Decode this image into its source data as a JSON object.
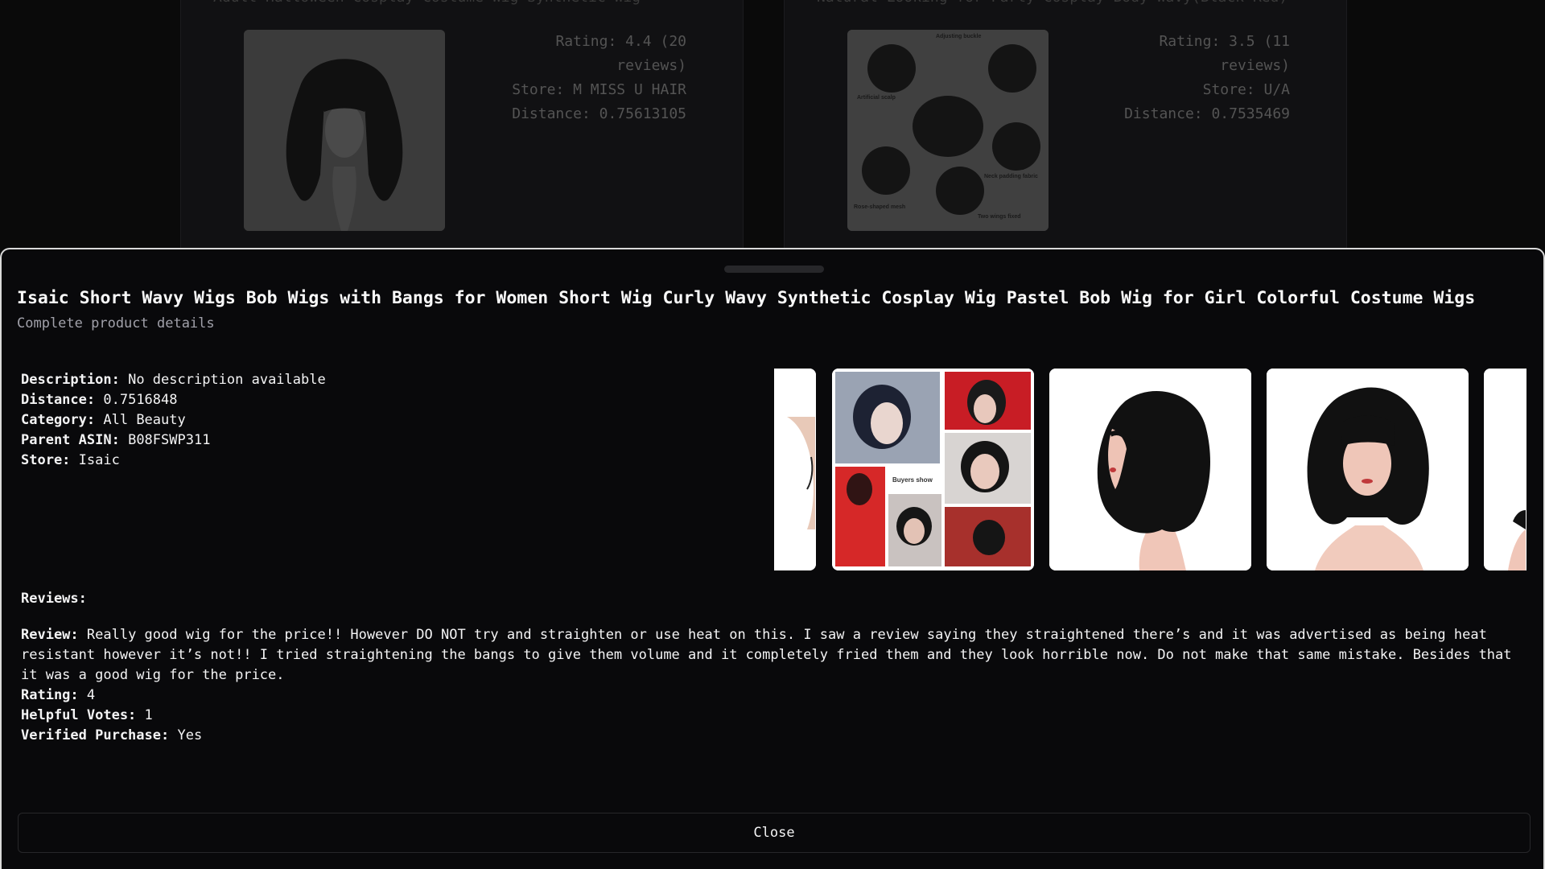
{
  "background": {
    "cards": [
      {
        "title": "Adult Halloween Cosplay Costume Wig Synthetic Wig",
        "rating": "Rating: 4.4 (20 reviews)",
        "store": "Store: M MISS U HAIR",
        "distance": "Distance: 0.75613105"
      },
      {
        "title": "Natural Looking for Party Cosplay Body Wavy(Black Red)",
        "rating": "Rating: 3.5 (11 reviews)",
        "store": "Store: U/A",
        "distance": "Distance: 0.7535469",
        "image_labels": [
          "Adjusting buckle",
          "Artificial scalp",
          "Neck padding fabric",
          "Rose-shaped mesh",
          "Two wings fixed"
        ]
      }
    ]
  },
  "modal": {
    "title": "Isaic Short Wavy Wigs Bob Wigs with Bangs for Women Short Wig Curly Wavy Synthetic Cosplay Wig Pastel Bob Wig for Girl Colorful Costume Wigs",
    "subtitle": "Complete product details",
    "details": [
      {
        "label": "Description:",
        "value": "No description available"
      },
      {
        "label": "Distance:",
        "value": "0.7516848"
      },
      {
        "label": "Category:",
        "value": "All Beauty"
      },
      {
        "label": "Parent ASIN:",
        "value": "B08FSWP311"
      },
      {
        "label": "Store:",
        "value": "Isaic"
      }
    ],
    "carousel": {
      "buyers_show_label": "Buyers show"
    },
    "reviews_heading": "Reviews:",
    "review": {
      "label": "Review:",
      "text": "Really good wig for the price!! However DO NOT try and straighten or use heat on this. I saw a review saying they straightened there’s and it was advertised as being heat resistant however it’s not!! I tried straightening the bangs to give them volume and it completely fried them and they look horrible now. Do not make that same mistake. Besides that it was a good wig for the price.",
      "rating_label": "Rating:",
      "rating": "4",
      "helpful_label": "Helpful Votes:",
      "helpful": "1",
      "verified_label": "Verified Purchase:",
      "verified": "Yes"
    },
    "close_label": "Close"
  }
}
